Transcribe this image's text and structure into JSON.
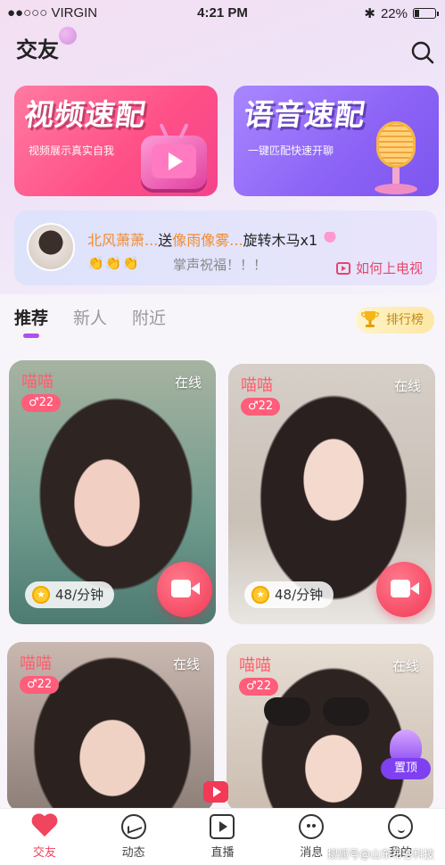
{
  "status_bar": {
    "carrier": "●●○○○ VIRGIN",
    "time": "4:21 PM",
    "battery": "22%",
    "battery_level": 0.22
  },
  "header": {
    "title": "交友"
  },
  "banners": [
    {
      "title": "视频速配",
      "subtitle": "视频展示真实自我"
    },
    {
      "title": "语音速配",
      "subtitle": "一键匹配快速开聊"
    }
  ],
  "notice": {
    "name": "北风萧萧...",
    "sent": "送",
    "receiver": "像雨像雾...",
    "gift": "旋转木马x1",
    "claps": "👏👏👏",
    "message": "掌声祝福！！！",
    "howto_label": "如何上电视"
  },
  "tabs": [
    "推荐",
    "新人",
    "附近"
  ],
  "rank_label": "排行榜",
  "cards": [
    {
      "name": "喵喵",
      "gender": "♂22",
      "status": "在线",
      "price": "48/分钟"
    },
    {
      "name": "喵喵",
      "gender": "♂22",
      "status": "在线",
      "price": "48/分钟"
    },
    {
      "name": "喵喵",
      "gender": "♂22",
      "status": "在线"
    },
    {
      "name": "喵喵",
      "gender": "♂22",
      "status": "在线"
    }
  ],
  "pin_label": "置顶",
  "bottom_nav": [
    {
      "label": "交友",
      "icon": "heart-icon"
    },
    {
      "label": "动态",
      "icon": "trend-icon"
    },
    {
      "label": "直播",
      "icon": "live-tv-icon"
    },
    {
      "label": "消息",
      "icon": "message-icon"
    },
    {
      "label": "我的",
      "icon": "profile-icon"
    }
  ],
  "watermark": "搜狐号@山东布谷科技",
  "colors": {
    "accent": "#f0445f",
    "video_banner": "#ff4f87",
    "voice_banner": "#8b62f5",
    "tab_indicator": "#b44cf0"
  }
}
